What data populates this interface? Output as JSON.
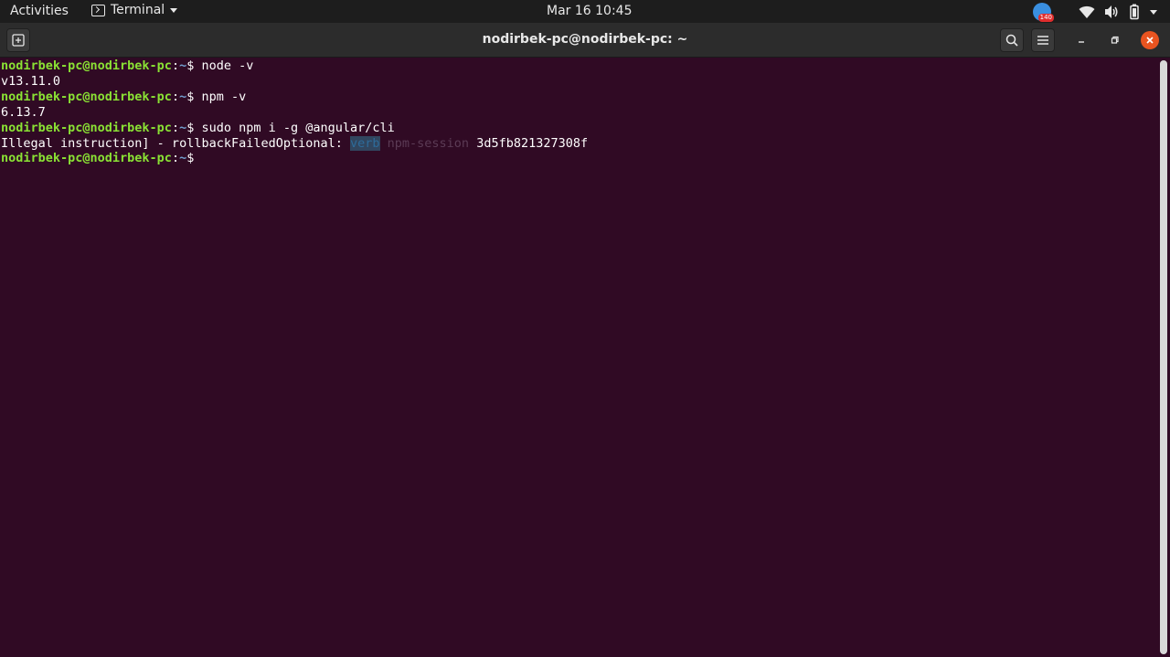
{
  "topbar": {
    "activities": "Activities",
    "app_name": "Terminal",
    "clock": "Mar 16  10:45",
    "app_badge": "140"
  },
  "window": {
    "title": "nodirbek-pc@nodirbek-pc: ~"
  },
  "terminal": {
    "prompt_user": "nodirbek-pc@nodirbek-pc",
    "prompt_sep": ":",
    "prompt_path": "~",
    "prompt_symbol": "$",
    "lines": [
      {
        "type": "cmd",
        "text": " node -v"
      },
      {
        "type": "out",
        "text": "v13.11.0"
      },
      {
        "type": "cmd",
        "text": " npm -v"
      },
      {
        "type": "out",
        "text": "6.13.7"
      },
      {
        "type": "cmd",
        "text": " sudo npm i -g @angular/cli"
      },
      {
        "type": "err",
        "prefix": "Illegal instruction] - rollbackFailedOptional: ",
        "verb": "verb",
        "session": " npm-session",
        "id": " 3d5fb821327308f"
      },
      {
        "type": "cmd",
        "text": ""
      }
    ]
  },
  "colors": {
    "background": "#300a24",
    "prompt_user": "#8ae234",
    "prompt_path": "#729fcf",
    "close_button": "#e95420"
  }
}
